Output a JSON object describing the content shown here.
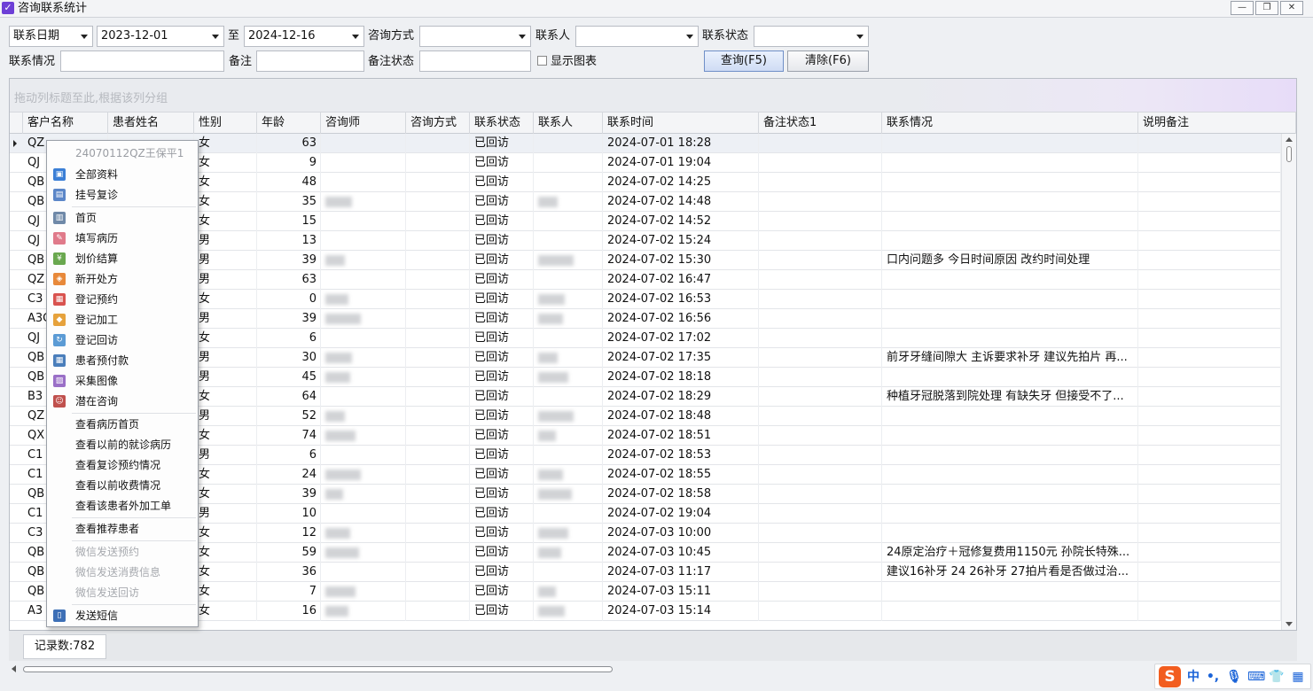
{
  "window": {
    "title": "咨询联系统计",
    "controls": [
      "minimize",
      "restore",
      "close"
    ]
  },
  "filters": {
    "date_type": "联系日期",
    "date_from": "2023-12-01",
    "to_label": "至",
    "date_to": "2024-12-16",
    "consult_method_label": "咨询方式",
    "consult_method_value": "",
    "contact_person_label": "联系人",
    "contact_person_value": "",
    "contact_status_label": "联系状态",
    "contact_status_value": "",
    "contact_info_label": "联系情况",
    "contact_info_value": "",
    "remark_label": "备注",
    "remark_value": "",
    "remark_status_label": "备注状态",
    "remark_status_value": "",
    "show_chart_label": "显示图表",
    "show_chart_checked": false,
    "query_button": "查询(F5)",
    "clear_button": "清除(F6)"
  },
  "grid": {
    "group_panel_hint": "拖动列标题至此,根据该列分组",
    "columns": [
      "客户名称",
      "患者姓名",
      "性别",
      "年龄",
      "咨询师",
      "咨询方式",
      "联系状态",
      "联系人",
      "联系时间",
      "备注状态1",
      "联系情况",
      "说明备注"
    ],
    "rows": [
      {
        "customer": "QZ",
        "gender": "女",
        "age": "63",
        "status": "已回访",
        "time": "2024-07-01 18:28",
        "note": ""
      },
      {
        "customer": "QJ",
        "gender": "女",
        "age": "9",
        "status": "已回访",
        "time": "2024-07-01 19:04",
        "note": ""
      },
      {
        "customer": "QB",
        "gender": "女",
        "age": "48",
        "status": "已回访",
        "time": "2024-07-02 14:25",
        "note": ""
      },
      {
        "customer": "QB",
        "gender": "女",
        "age": "35",
        "status": "已回访",
        "time": "2024-07-02 14:48",
        "note": ""
      },
      {
        "customer": "QJ",
        "gender": "女",
        "age": "15",
        "status": "已回访",
        "time": "2024-07-02 14:52",
        "note": ""
      },
      {
        "customer": "QJ",
        "gender": "男",
        "age": "13",
        "status": "已回访",
        "time": "2024-07-02 15:24",
        "note": ""
      },
      {
        "customer": "QB",
        "gender": "男",
        "age": "39",
        "status": "已回访",
        "time": "2024-07-02 15:30",
        "note": "口内问题多 今日时间原因  改约时间处理"
      },
      {
        "customer": "QZ",
        "gender": "男",
        "age": "63",
        "status": "已回访",
        "time": "2024-07-02 16:47",
        "note": ""
      },
      {
        "customer": "C3",
        "gender": "女",
        "age": "0",
        "status": "已回访",
        "time": "2024-07-02 16:53",
        "note": ""
      },
      {
        "customer": "A3C",
        "gender": "男",
        "age": "39",
        "status": "已回访",
        "time": "2024-07-02 16:56",
        "note": ""
      },
      {
        "customer": "QJ",
        "gender": "女",
        "age": "6",
        "status": "已回访",
        "time": "2024-07-02 17:02",
        "note": ""
      },
      {
        "customer": "QB",
        "gender": "男",
        "age": "30",
        "status": "已回访",
        "time": "2024-07-02 17:35",
        "note": "前牙牙缝间隙大 主诉要求补牙  建议先拍片 再..."
      },
      {
        "customer": "QB",
        "gender": "男",
        "age": "45",
        "status": "已回访",
        "time": "2024-07-02 18:18",
        "note": ""
      },
      {
        "customer": "B3",
        "gender": "女",
        "age": "64",
        "status": "已回访",
        "time": "2024-07-02 18:29",
        "note": "种植牙冠脱落到院处理  有缺失牙 但接受不了..."
      },
      {
        "customer": "QZ",
        "gender": "男",
        "age": "52",
        "status": "已回访",
        "time": "2024-07-02 18:48",
        "note": ""
      },
      {
        "customer": "QX",
        "gender": "女",
        "age": "74",
        "status": "已回访",
        "time": "2024-07-02 18:51",
        "note": ""
      },
      {
        "customer": "C1",
        "gender": "男",
        "age": "6",
        "status": "已回访",
        "time": "2024-07-02 18:53",
        "note": ""
      },
      {
        "customer": "C1",
        "gender": "女",
        "age": "24",
        "status": "已回访",
        "time": "2024-07-02 18:55",
        "note": ""
      },
      {
        "customer": "QB",
        "gender": "女",
        "age": "39",
        "status": "已回访",
        "time": "2024-07-02 18:58",
        "note": ""
      },
      {
        "customer": "C1",
        "gender": "男",
        "age": "10",
        "status": "已回访",
        "time": "2024-07-02 19:04",
        "note": ""
      },
      {
        "customer": "C3",
        "gender": "女",
        "age": "12",
        "status": "已回访",
        "time": "2024-07-03 10:00",
        "note": ""
      },
      {
        "customer": "QB",
        "gender": "女",
        "age": "59",
        "status": "已回访",
        "time": "2024-07-03 10:45",
        "note": "24原定治疗＋冠修复费用1150元 孙院长特殊..."
      },
      {
        "customer": "QB",
        "gender": "女",
        "age": "36",
        "status": "已回访",
        "time": "2024-07-03 11:17",
        "note": "建议16补牙 24 26补牙 27拍片看是否做过治..."
      },
      {
        "customer": "QB",
        "gender": "女",
        "age": "7",
        "status": "已回访",
        "time": "2024-07-03 15:11",
        "note": ""
      },
      {
        "customer": "A3",
        "gender": "女",
        "age": "16",
        "status": "已回访",
        "time": "2024-07-03 15:14",
        "note": ""
      }
    ],
    "record_count": "记录数:782"
  },
  "context_menu": {
    "header": "24070112QZ王保平1",
    "items": [
      {
        "label": "全部资料",
        "icon": "profile-card-icon",
        "color": "#3b7fd6"
      },
      {
        "label": "挂号复诊",
        "icon": "id-card-icon",
        "color": "#5b86c8"
      },
      {
        "label": "首页",
        "icon": "home-page-icon",
        "color": "#6f89a8"
      },
      {
        "label": "填写病历",
        "icon": "medical-record-icon",
        "color": "#e07a8a"
      },
      {
        "label": "划价结算",
        "icon": "settlement-icon",
        "color": "#6aa84f"
      },
      {
        "label": "新开处方",
        "icon": "pill-icon",
        "color": "#e8893a"
      },
      {
        "label": "登记预约",
        "icon": "appointment-calendar-icon",
        "color": "#d9534f"
      },
      {
        "label": "登记加工",
        "icon": "processing-icon",
        "color": "#e6a23c"
      },
      {
        "label": "登记回访",
        "icon": "refresh-cycle-icon",
        "color": "#5b9bd5"
      },
      {
        "label": "患者预付款",
        "icon": "prepayment-grid-icon",
        "color": "#4a7ebb"
      },
      {
        "label": "采集图像",
        "icon": "image-capture-icon",
        "color": "#9a6fc7"
      },
      {
        "label": "潜在咨询",
        "icon": "user-consult-icon",
        "color": "#c0504d"
      },
      {
        "label": "查看病历首页",
        "icon": "",
        "color": ""
      },
      {
        "label": "查看以前的就诊病历",
        "icon": "",
        "color": ""
      },
      {
        "label": "查看复诊预约情况",
        "icon": "",
        "color": ""
      },
      {
        "label": "查看以前收费情况",
        "icon": "",
        "color": ""
      },
      {
        "label": "查看该患者外加工单",
        "icon": "",
        "color": ""
      },
      {
        "label": "查看推荐患者",
        "icon": "",
        "color": ""
      },
      {
        "label": "微信发送预约",
        "icon": "",
        "color": ""
      },
      {
        "label": "微信发送消费信息",
        "icon": "",
        "color": ""
      },
      {
        "label": "微信发送回访",
        "icon": "",
        "color": ""
      },
      {
        "label": "发送短信",
        "icon": "phone-sms-icon",
        "color": "#3d6fb6"
      }
    ],
    "disabled": [
      "微信发送预约",
      "微信发送消费信息",
      "微信发送回访"
    ]
  },
  "ime_toolbar": {
    "logo": "S",
    "lang": "中",
    "icons": [
      "punctuation-icon",
      "microphone-icon",
      "keyboard-icon",
      "skin-shirt-icon",
      "toolbox-grid-icon"
    ],
    "accent": "#f25d1f"
  }
}
